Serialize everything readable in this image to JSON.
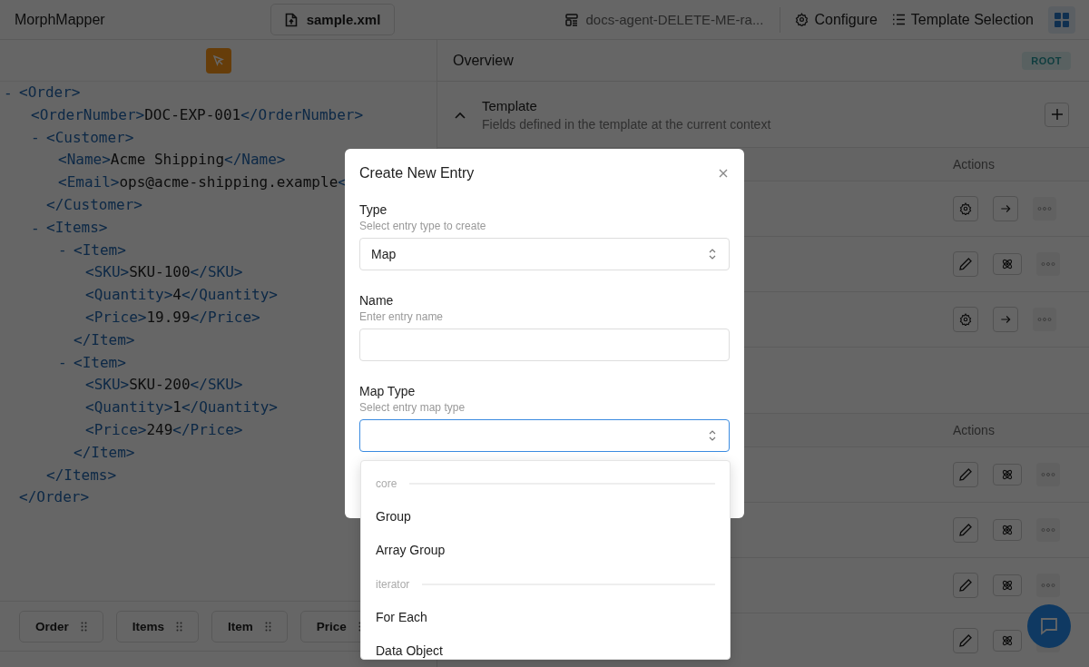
{
  "app": {
    "title": "MorphMapper"
  },
  "header": {
    "file_button": "sample.xml",
    "workspace": "docs-agent-DELETE-ME-ra...",
    "configure": "Configure",
    "template_selection": "Template Selection"
  },
  "xml_tree": [
    {
      "marker": "-",
      "open": "<Order>",
      "close": "</Order>",
      "children": [
        {
          "open": "<OrderNumber>",
          "text": "DOC-EXP-001",
          "close": "</OrderNumber>"
        },
        {
          "marker": "-",
          "open": "<Customer>",
          "close": "</Customer>",
          "children": [
            {
              "open": "<Name>",
              "text": "Acme Shipping",
              "close": "</Name>"
            },
            {
              "open": "<Email>",
              "text": "ops@acme-shipping.example",
              "close": "<"
            }
          ]
        },
        {
          "marker": "-",
          "open": "<Items>",
          "close": "</Items>",
          "children": [
            {
              "marker": "-",
              "open": "<Item>",
              "close": "</Item>",
              "children": [
                {
                  "open": "<SKU>",
                  "text": "SKU-100",
                  "close": "</SKU>"
                },
                {
                  "open": "<Quantity>",
                  "text": "4",
                  "close": "</Quantity>"
                },
                {
                  "open": "<Price>",
                  "text": "19.99",
                  "close": "</Price>"
                }
              ]
            },
            {
              "marker": "-",
              "open": "<Item>",
              "close": "</Item>",
              "children": [
                {
                  "open": "<SKU>",
                  "text": "SKU-200",
                  "close": "</SKU>"
                },
                {
                  "open": "<Quantity>",
                  "text": "1",
                  "close": "</Quantity>"
                },
                {
                  "open": "<Price>",
                  "text": "249",
                  "close": "</Price>"
                }
              ]
            }
          ]
        }
      ]
    }
  ],
  "path_chips": [
    "Order",
    "Items",
    "Item",
    "Price"
  ],
  "overview": {
    "title": "Overview",
    "badge": "ROOT",
    "section": {
      "title": "Template",
      "subtitle": "Fields defined in the template at the current context",
      "expanded": true
    }
  },
  "tables": [
    {
      "actions_header": "Actions",
      "rows": [
        {
          "kind": "settings"
        },
        {
          "kind": "edit"
        },
        {
          "kind": "settings"
        }
      ]
    },
    {
      "actions_header": "Actions",
      "rows": [
        {
          "kind": "edit"
        },
        {
          "kind": "edit"
        },
        {
          "kind": "edit"
        },
        {
          "kind": "edit"
        }
      ]
    }
  ],
  "dialog": {
    "title": "Create New Entry",
    "fields": [
      {
        "kind": "select",
        "label": "Type",
        "hint": "Select entry type to create",
        "value": "Map",
        "focused": false
      },
      {
        "kind": "text",
        "label": "Name",
        "hint": "Enter entry name",
        "focused": false
      },
      {
        "kind": "select",
        "label": "Map Type",
        "hint": "Select entry map type",
        "focused": true
      }
    ]
  },
  "dropdown": {
    "groups": [
      {
        "label": "core",
        "options": [
          "Group",
          "Array Group"
        ]
      },
      {
        "label": "iterator",
        "options": [
          "For Each",
          "Data Object"
        ]
      }
    ]
  }
}
